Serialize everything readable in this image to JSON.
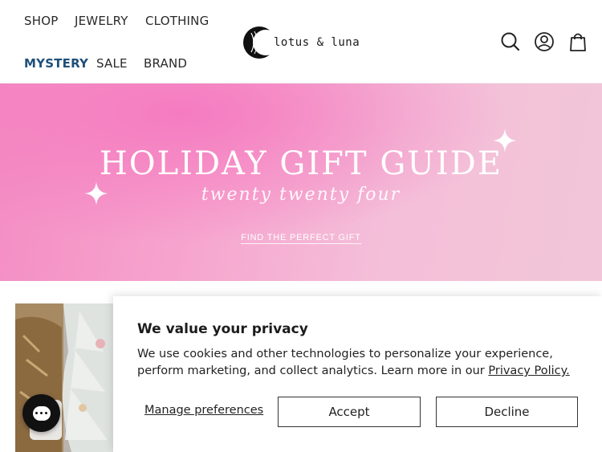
{
  "nav": {
    "shop": "SHOP",
    "jewelry": "JEWELRY",
    "clothing": "CLOTHING",
    "mystery": "MYSTERY",
    "sale": "SALE",
    "brand": "BRAND"
  },
  "logo": {
    "text": "lotus & luna"
  },
  "header_icons": [
    "search-icon",
    "account-icon",
    "shopping-bag-icon"
  ],
  "hero": {
    "title": "HOLIDAY GIFT GUIDE",
    "script": "twenty twenty four",
    "link": "FIND THE PERFECT GIFT"
  },
  "cookie": {
    "title": "We value your privacy",
    "body": "We use cookies and other technologies to personalize your experience, perform marketing, and collect analytics. Learn more in our ",
    "policy_link": "Privacy Policy.",
    "manage": "Manage preferences",
    "accept": "Accept",
    "decline": "Decline"
  },
  "colors": {
    "accent_nav": "#1f4f7a",
    "hero_pink": "#f48cc3",
    "chat_bg": "#111111"
  }
}
